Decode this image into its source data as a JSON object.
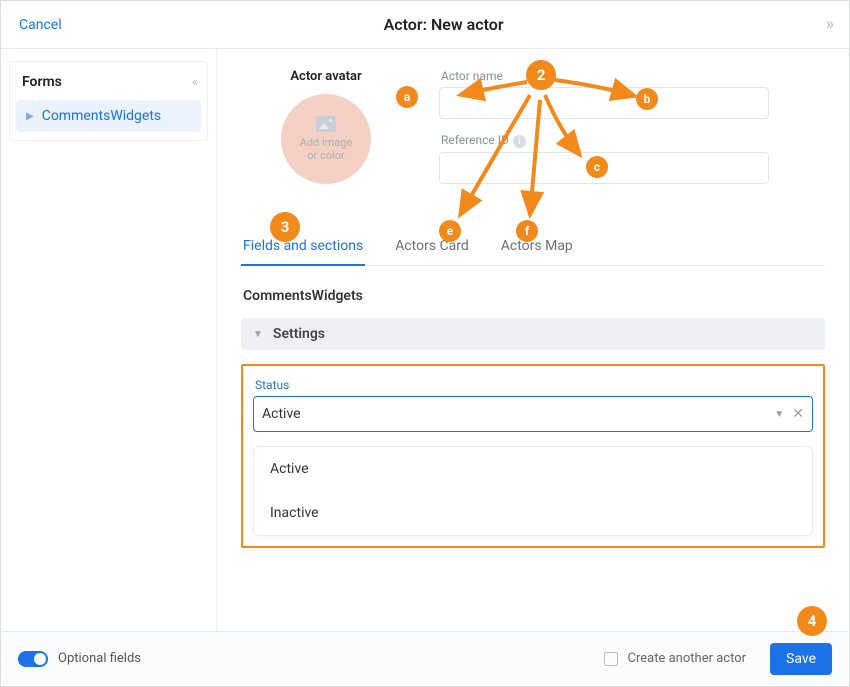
{
  "header": {
    "cancel": "Cancel",
    "title": "Actor: New actor"
  },
  "sidebar": {
    "heading": "Forms",
    "items": [
      {
        "label": "CommentsWidgets"
      }
    ]
  },
  "avatar": {
    "label": "Actor avatar",
    "placeholder": "Add image\nor color"
  },
  "fields": {
    "name_label": "Actor name",
    "name_value": "",
    "ref_label": "Reference ID",
    "ref_value": ""
  },
  "tabs": [
    {
      "label": "Fields and sections",
      "active": true
    },
    {
      "label": "Actors Card",
      "active": false
    },
    {
      "label": "Actors Map",
      "active": false
    }
  ],
  "section": {
    "title": "CommentsWidgets",
    "group": "Settings"
  },
  "status": {
    "label": "Status",
    "value": "Active",
    "options": [
      "Active",
      "Inactive"
    ]
  },
  "footer": {
    "optional": "Optional fields",
    "create_another": "Create another actor",
    "save": "Save"
  },
  "callouts": {
    "big": [
      "2",
      "3",
      "4"
    ],
    "small": [
      "a",
      "b",
      "c",
      "e",
      "f"
    ]
  },
  "colors": {
    "accent": "#1b73e7",
    "highlight": "#f28a1b"
  }
}
